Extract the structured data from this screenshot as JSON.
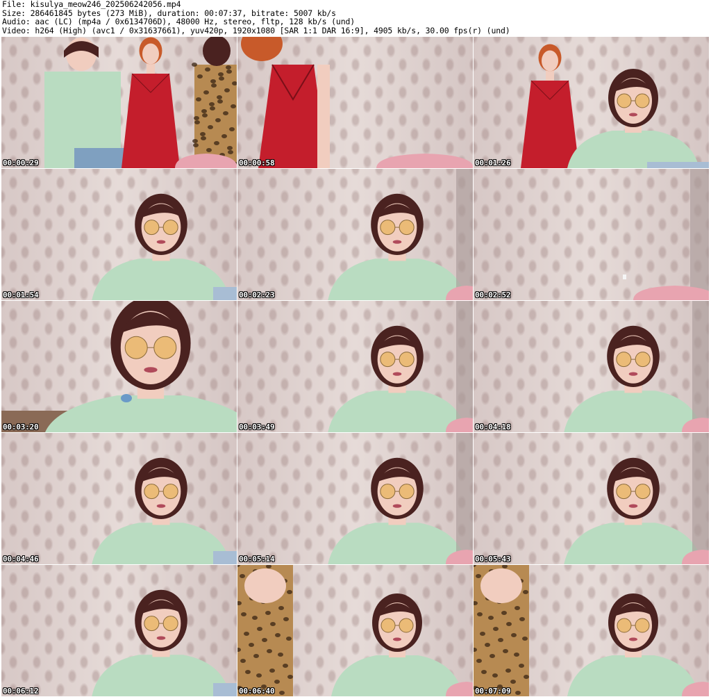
{
  "header": {
    "line_file": "File: kisulya_meow246_202506242056.mp4",
    "line_size": "Size: 286461845 bytes (273 MiB), duration: 00:07:37, bitrate: 5007 kb/s",
    "line_audio": "Audio: aac (LC) (mp4a / 0x6134706D), 48000 Hz, stereo, fltp, 128 kb/s (und)",
    "line_video": "Video: h264 (High) (avc1 / 0x31637661), yuv420p, 1920x1080 [SAR 1:1 DAR 16:9], 4905 kb/s, 30.00 fps(r) (und)"
  },
  "thumbnails": [
    {
      "timestamp": "00:00:29",
      "scene": "group"
    },
    {
      "timestamp": "00:00:58",
      "scene": "red-dress-close"
    },
    {
      "timestamp": "00:01:26",
      "scene": "red-dress-and-glasses"
    },
    {
      "timestamp": "00:01:54",
      "scene": "glasses-center"
    },
    {
      "timestamp": "00:02:23",
      "scene": "glasses-right"
    },
    {
      "timestamp": "00:02:52",
      "scene": "empty-room"
    },
    {
      "timestamp": "00:03:20",
      "scene": "glasses-closeup"
    },
    {
      "timestamp": "00:03:49",
      "scene": "glasses-right"
    },
    {
      "timestamp": "00:04:18",
      "scene": "glasses-right"
    },
    {
      "timestamp": "00:04:46",
      "scene": "glasses-center"
    },
    {
      "timestamp": "00:05:14",
      "scene": "glasses-right"
    },
    {
      "timestamp": "00:05:43",
      "scene": "glasses-right"
    },
    {
      "timestamp": "00:06:12",
      "scene": "glasses-center"
    },
    {
      "timestamp": "00:06:40",
      "scene": "leopard-and-glasses"
    },
    {
      "timestamp": "00:07:09",
      "scene": "leopard-and-glasses"
    }
  ],
  "colors": {
    "wallpaper": "#ddd0cd",
    "shirt_mint": "#b9dcc1",
    "hair_dark": "#4a2220",
    "hair_red": "#c85a2a",
    "dress_red": "#c41e2c",
    "leopard": "#b78a52",
    "chair_pink": "#e8a4b0",
    "skin": "#f1cdbf",
    "lens_amber": "#e8b458"
  }
}
